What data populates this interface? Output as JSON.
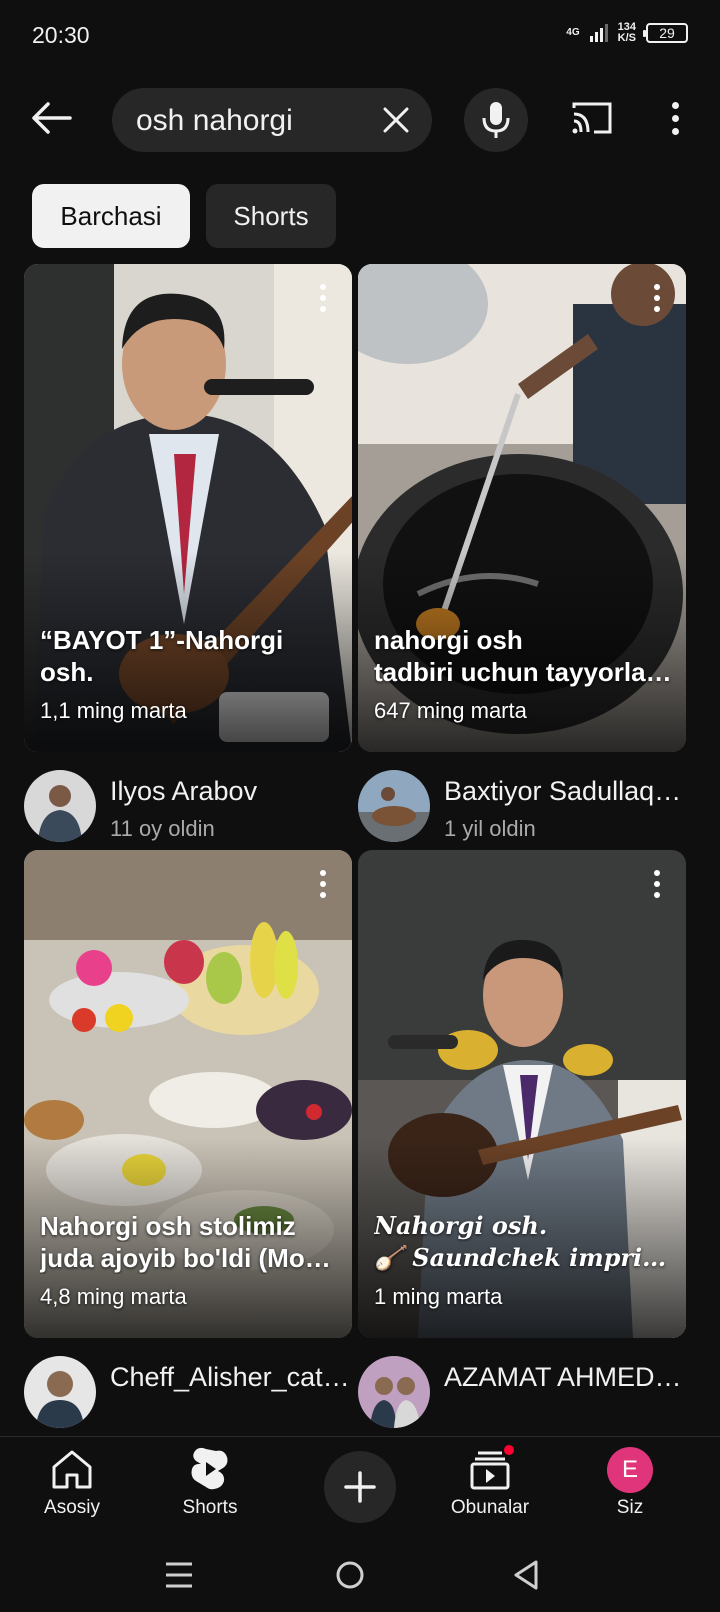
{
  "status_bar": {
    "time": "20:30",
    "network": "4G",
    "speed_value": "134",
    "speed_unit": "K/S",
    "battery": "29"
  },
  "search": {
    "query": "osh nahorgi",
    "icons": {
      "back": "arrow-left-icon",
      "clear": "close-icon",
      "mic": "microphone-icon",
      "cast": "cast-icon",
      "more": "more-vertical-icon"
    }
  },
  "chips": [
    {
      "label": "Barchasi",
      "active": true
    },
    {
      "label": "Shorts",
      "active": false
    }
  ],
  "videos": [
    {
      "title_lines": [
        "“BAYOT 1”-Nahorgi",
        "osh."
      ],
      "views": "1,1 ming marta",
      "channel": "Ilyos Arabov",
      "age": "11 oy oldin"
    },
    {
      "title_lines": [
        "nahorgi osh",
        "tadbiri uchun tayyorlash"
      ],
      "views": "647 ming marta",
      "channel": "Baxtiyor Sadullaqulov",
      "age": "1 yil oldin"
    },
    {
      "title_lines": [
        "Nahorgi osh stolimiz",
        "juda ajoyib bo'ldi (Morozhniy"
      ],
      "views": "4,8 ming marta",
      "channel": "Cheff_Alisher_catering",
      "age": ""
    },
    {
      "title_lines": [
        "Nahorgi osh.",
        "🪕 Saundchek imprivizatsiya"
      ],
      "views": "1 ming marta",
      "channel": "AZAMAT AHMEDOV",
      "age": ""
    }
  ],
  "bottom_nav": [
    {
      "label": "Asosiy",
      "icon": "home-icon"
    },
    {
      "label": "Shorts",
      "icon": "shorts-icon"
    },
    {
      "label": "",
      "icon": "create-plus-icon"
    },
    {
      "label": "Obunalar",
      "icon": "subscriptions-icon"
    },
    {
      "label": "Siz",
      "icon": "profile-avatar",
      "avatar_letter": "E"
    }
  ],
  "colors": {
    "background": "#0f0f0f",
    "chip_bg": "#272727",
    "accent_red": "#ff0033",
    "profile_pink": "#e0357a"
  }
}
